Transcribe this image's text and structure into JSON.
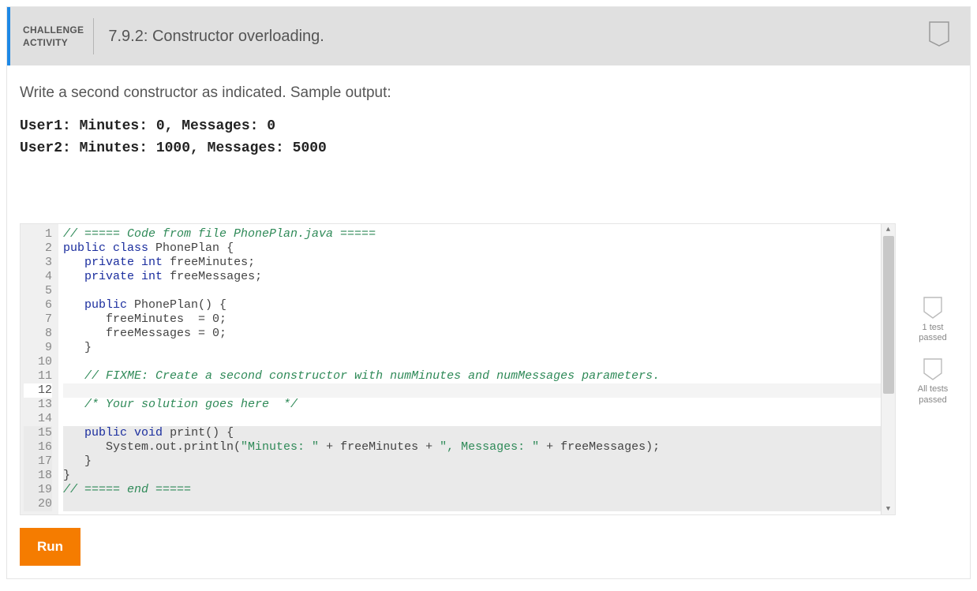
{
  "header": {
    "label_line1": "CHALLENGE",
    "label_line2": "ACTIVITY",
    "title": "7.9.2: Constructor overloading."
  },
  "instructions": "Write a second constructor as indicated. Sample output:",
  "sample_output": "User1: Minutes: 0, Messages: 0\nUser2: Minutes: 1000, Messages: 5000",
  "badges": [
    {
      "label": "1 test\npassed"
    },
    {
      "label": "All tests\npassed"
    }
  ],
  "run_label": "Run",
  "code_lines": [
    {
      "n": 1,
      "tokens": [
        [
          "c",
          "// ===== Code from file PhonePlan.java ====="
        ]
      ]
    },
    {
      "n": 2,
      "tokens": [
        [
          "k",
          "public"
        ],
        [
          "n",
          " "
        ],
        [
          "k",
          "class"
        ],
        [
          "n",
          " PhonePlan {"
        ]
      ]
    },
    {
      "n": 3,
      "tokens": [
        [
          "n",
          "   "
        ],
        [
          "k",
          "private"
        ],
        [
          "n",
          " "
        ],
        [
          "t",
          "int"
        ],
        [
          "n",
          " freeMinutes;"
        ]
      ]
    },
    {
      "n": 4,
      "tokens": [
        [
          "n",
          "   "
        ],
        [
          "k",
          "private"
        ],
        [
          "n",
          " "
        ],
        [
          "t",
          "int"
        ],
        [
          "n",
          " freeMessages;"
        ]
      ]
    },
    {
      "n": 5,
      "tokens": []
    },
    {
      "n": 6,
      "tokens": [
        [
          "n",
          "   "
        ],
        [
          "k",
          "public"
        ],
        [
          "n",
          " PhonePlan() {"
        ]
      ]
    },
    {
      "n": 7,
      "tokens": [
        [
          "n",
          "      freeMinutes  = 0;"
        ]
      ]
    },
    {
      "n": 8,
      "tokens": [
        [
          "n",
          "      freeMessages = 0;"
        ]
      ]
    },
    {
      "n": 9,
      "tokens": [
        [
          "n",
          "   }"
        ]
      ]
    },
    {
      "n": 10,
      "tokens": []
    },
    {
      "n": 11,
      "tokens": [
        [
          "n",
          "   "
        ],
        [
          "c",
          "// FIXME: Create a second constructor with numMinutes and numMessages parameters."
        ]
      ]
    },
    {
      "n": 12,
      "tokens": [],
      "active": true
    },
    {
      "n": 13,
      "tokens": [
        [
          "n",
          "   "
        ],
        [
          "c",
          "/* Your solution goes here  */"
        ]
      ]
    },
    {
      "n": 14,
      "tokens": []
    },
    {
      "n": 15,
      "tokens": [
        [
          "n",
          "   "
        ],
        [
          "k",
          "public"
        ],
        [
          "n",
          " "
        ],
        [
          "t",
          "void"
        ],
        [
          "n",
          " print() {"
        ]
      ],
      "hl": true
    },
    {
      "n": 16,
      "tokens": [
        [
          "n",
          "      System.out.println("
        ],
        [
          "s",
          "\"Minutes: \""
        ],
        [
          "n",
          " + freeMinutes + "
        ],
        [
          "s",
          "\", Messages: \""
        ],
        [
          "n",
          " + freeMessages);"
        ]
      ],
      "hl": true
    },
    {
      "n": 17,
      "tokens": [
        [
          "n",
          "   }"
        ]
      ],
      "hl": true
    },
    {
      "n": 18,
      "tokens": [
        [
          "n",
          "}"
        ]
      ],
      "hl": true
    },
    {
      "n": 19,
      "tokens": [
        [
          "c",
          "// ===== end ====="
        ]
      ],
      "hl": true
    },
    {
      "n": 20,
      "tokens": [],
      "hl": true
    }
  ]
}
